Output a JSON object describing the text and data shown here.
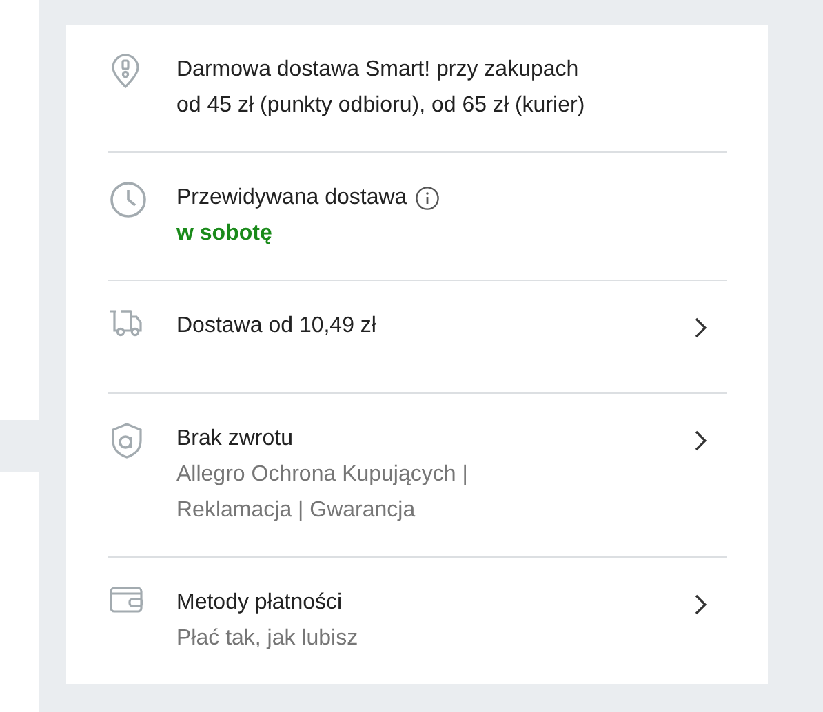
{
  "items": [
    {
      "kind": "pin",
      "title_lines": [
        "Darmowa dostawa Smart! przy zakupach",
        "od 45 zł (punkty odbioru), od 65 zł (kurier)"
      ],
      "info": false,
      "chevron": false
    },
    {
      "kind": "clock",
      "title_lines": [
        "Przewidywana dostawa"
      ],
      "info": true,
      "note": "w sobotę",
      "chevron": false
    },
    {
      "kind": "truck",
      "title_lines": [
        "Dostawa od 10,49 zł"
      ],
      "info": false,
      "chevron": true
    },
    {
      "kind": "shield",
      "title_lines": [
        "Brak zwrotu"
      ],
      "info": false,
      "subtitle_lines": [
        "Allegro Ochrona Kupujących |",
        "Reklamacja | Gwarancja"
      ],
      "chevron": true
    },
    {
      "kind": "wallet",
      "title_lines": [
        "Metody płatności"
      ],
      "info": false,
      "subtitle_lines": [
        "Płać tak, jak lubisz"
      ],
      "chevron": true
    }
  ]
}
